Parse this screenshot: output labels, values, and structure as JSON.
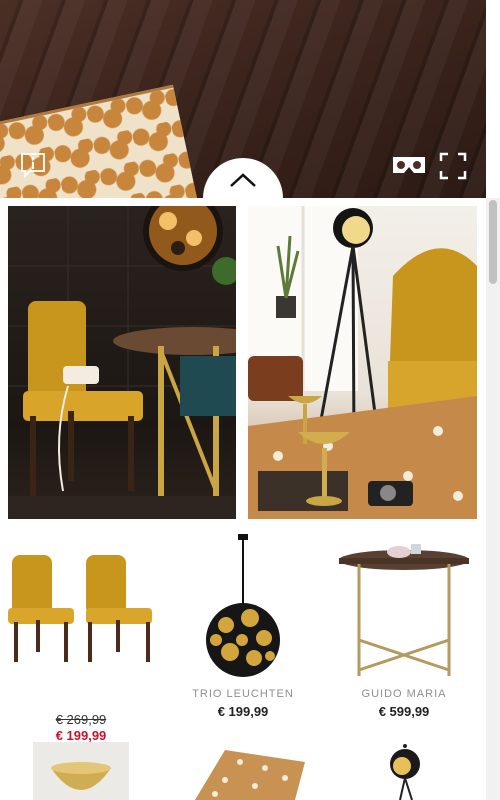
{
  "hero": {
    "info_icon": "info-icon",
    "vr_icon": "vr-goggles-icon",
    "fullscreen_icon": "fullscreen-icon",
    "collapse_icon": "chevron-up-icon"
  },
  "products": [
    {
      "brand": "",
      "old_price": "€ 269,99",
      "price": "€ 199,99",
      "sale": true
    },
    {
      "brand": "TRIO LEUCHTEN",
      "old_price": "",
      "price": "€ 199,99",
      "sale": false
    },
    {
      "brand": "GUIDO MARIA",
      "old_price": "",
      "price": "€ 599,99",
      "sale": false
    }
  ],
  "colors": {
    "sale": "#c8102e",
    "brand_gray": "#8e8e8e",
    "mustard": "#c9961d",
    "gold": "#c9a544"
  }
}
